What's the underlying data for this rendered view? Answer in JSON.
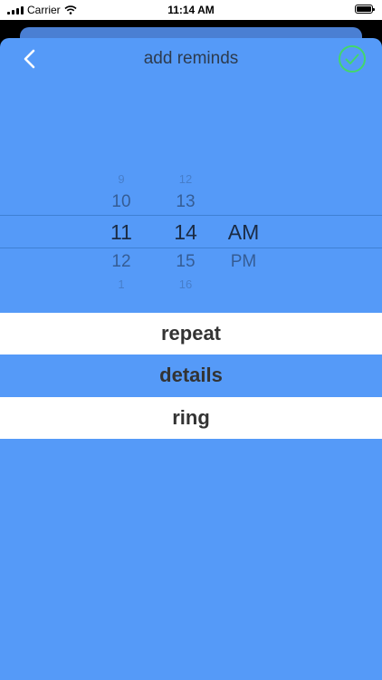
{
  "status_bar": {
    "carrier": "Carrier",
    "time": "11:14 AM"
  },
  "nav": {
    "title": "add reminds",
    "back_icon": "chevron-left-icon",
    "confirm_icon": "check-circle-icon"
  },
  "picker": {
    "hours": [
      "9",
      "10",
      "11",
      "12",
      "1"
    ],
    "minutes": [
      "12",
      "13",
      "14",
      "15",
      "16"
    ],
    "periods": [
      "AM",
      "PM"
    ],
    "selected": {
      "hour": "11",
      "minute": "14",
      "period": "AM"
    }
  },
  "options": [
    {
      "label": "repeat",
      "style": "white"
    },
    {
      "label": "details",
      "style": "blue"
    },
    {
      "label": "ring",
      "style": "white"
    }
  ],
  "colors": {
    "background": "#559af8",
    "title_text": "#2d3b4e",
    "confirm_icon": "#43d66c",
    "picker_text": "#1b2b44",
    "option_text": "#333333"
  }
}
